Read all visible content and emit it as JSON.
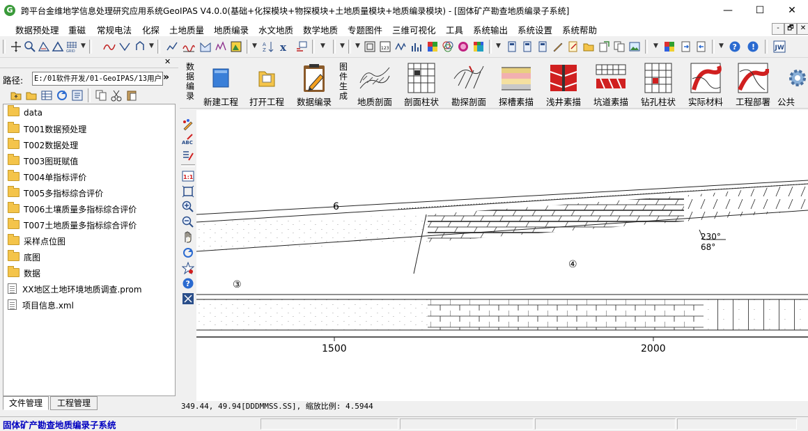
{
  "window": {
    "title": "跨平台金维地学信息处理研究应用系统GeoIPAS V4.0.0(基础+化探模块+物探模块+土地质量模块+地质编录模块) - [固体矿产勘查地质编录子系统]",
    "app_icon_letter": "G",
    "minimize": "—",
    "maximize": "☐",
    "close": "✕"
  },
  "menu": [
    "数据预处理",
    "重磁",
    "常规电法",
    "化探",
    "土地质量",
    "地质编录",
    "水文地质",
    "数学地质",
    "专题图件",
    "三维可视化",
    "工具",
    "系统输出",
    "系统设置",
    "系统帮助"
  ],
  "mdi_controls": [
    "-",
    "🗗",
    "✕"
  ],
  "left_panel": {
    "close": "✕",
    "path_label": "路径:",
    "path_value": "E:/01软件开发/01-GeoIPAS/13用户",
    "more": "»",
    "tree": [
      {
        "type": "folder",
        "label": "data"
      },
      {
        "type": "folder",
        "label": "T001数据预处理"
      },
      {
        "type": "folder",
        "label": "T002数据处理"
      },
      {
        "type": "folder",
        "label": "T003图斑赋值"
      },
      {
        "type": "folder",
        "label": "T004单指标评价"
      },
      {
        "type": "folder",
        "label": "T005多指标综合评价"
      },
      {
        "type": "folder",
        "label": "T006土壤质量多指标综合评价"
      },
      {
        "type": "folder",
        "label": "T007土地质量多指标综合评价"
      },
      {
        "type": "folder",
        "label": "采样点位图"
      },
      {
        "type": "folder",
        "label": "底图"
      },
      {
        "type": "folder",
        "label": "数据"
      },
      {
        "type": "file",
        "label": "XX地区土地环境地质调查.prom"
      },
      {
        "type": "file",
        "label": "项目信息.xml"
      }
    ],
    "tabs": [
      "文件管理",
      "工程管理"
    ]
  },
  "ribbon": {
    "group1": "数据编录",
    "group2": "图件生成",
    "buttons1": [
      "新建工程",
      "打开工程",
      "数据编录"
    ],
    "buttons2": [
      "地质剖面",
      "剖面柱状",
      "勘探剖面",
      "探槽素描",
      "浅井素描",
      "坑道素描",
      "钻孔柱状",
      "实际材料",
      "工程部署"
    ],
    "last": "公共"
  },
  "drawing": {
    "label_6": "6",
    "label_4": "④",
    "label_3": "③",
    "dip_direction": "230°",
    "dip_angle": "68°",
    "scale_1500": "1500",
    "scale_2000": "2000"
  },
  "coord_text": "349.44, 49.94[DDDMMSS.SS], 缩放比例: 4.5944",
  "status_text": "固体矿产勘查地质编录子系统"
}
